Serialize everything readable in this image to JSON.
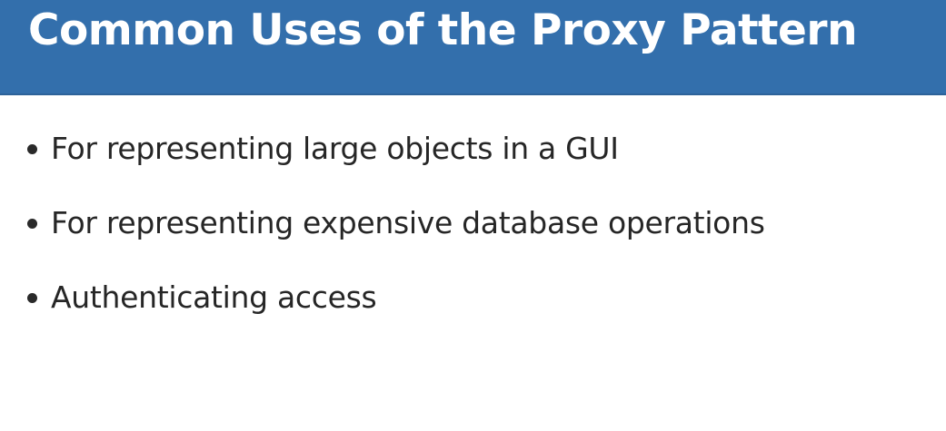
{
  "slide": {
    "title": "Common Uses of the Proxy Pattern",
    "bullets": [
      {
        "text": "For representing large objects in a GUI"
      },
      {
        "text": "For representing expensive database operations"
      },
      {
        "text": "Authenticating access"
      }
    ]
  },
  "colors": {
    "header_bg": "#336fac",
    "title_text": "#ffffff",
    "body_text": "#262626",
    "background": "#ffffff"
  }
}
